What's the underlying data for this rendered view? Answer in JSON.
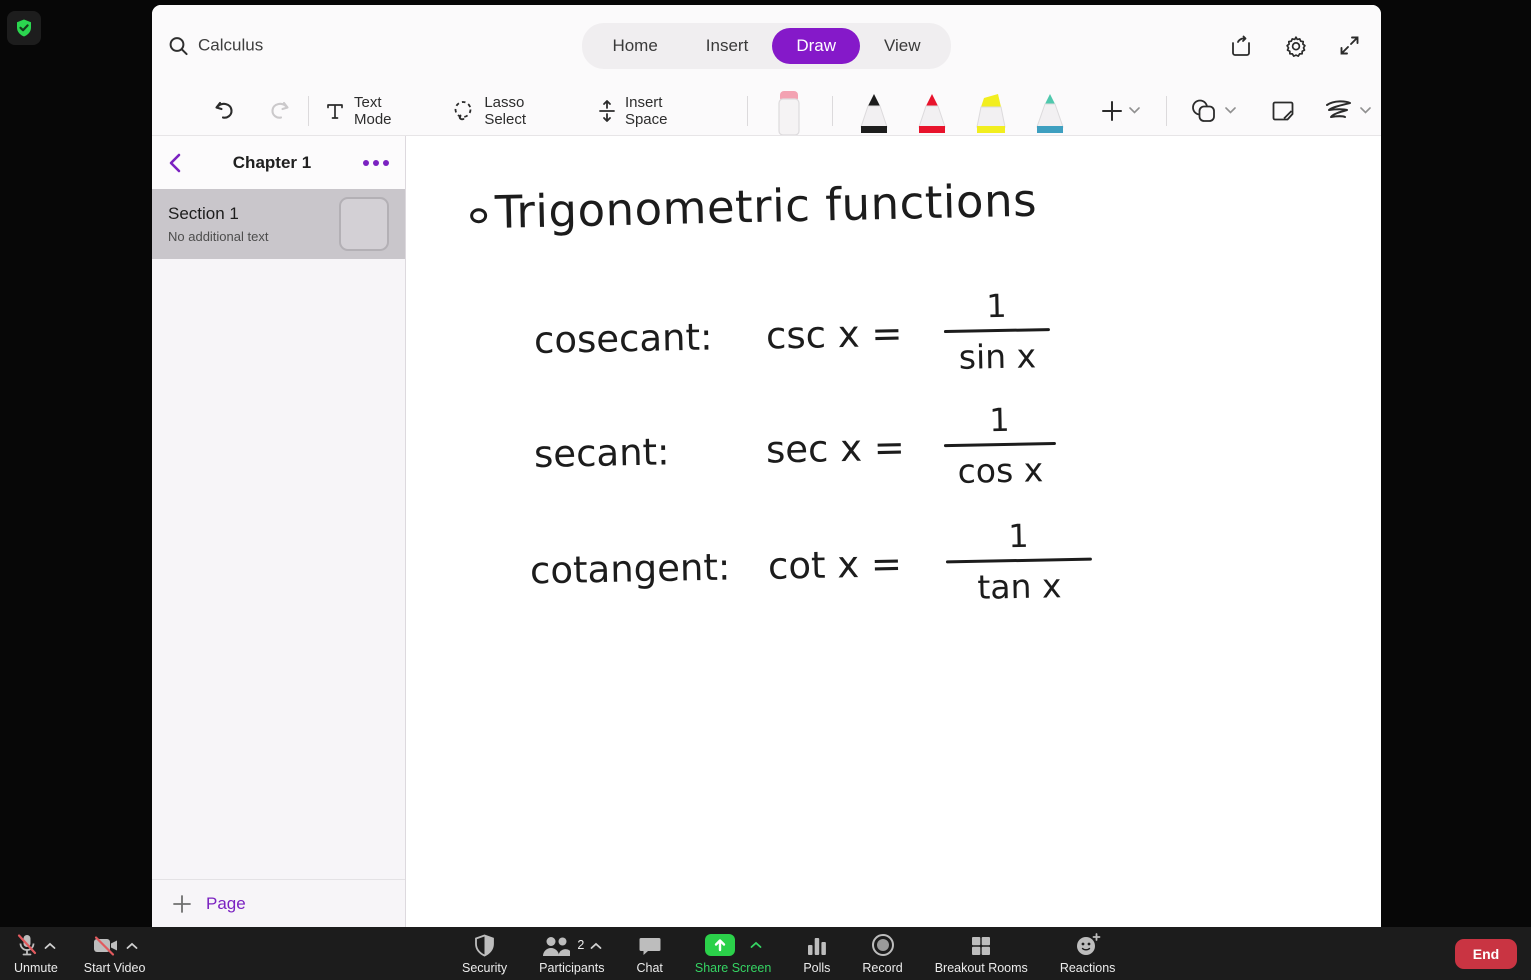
{
  "colors": {
    "accent_purple": "#8519c9",
    "share_green": "#2bd14a",
    "share_green_text": "#35d463",
    "end_red": "#c93442",
    "ink": "#1c1c1c",
    "selected_row_gray": "#c9c6cb"
  },
  "icons": [
    "shield-check-icon",
    "search-icon",
    "share-icon",
    "gear-icon",
    "expand-icon",
    "undo-icon",
    "redo-icon",
    "text-mode-icon",
    "lasso-icon",
    "insert-space-icon",
    "eraser-icon",
    "pen-black-icon",
    "pen-red-icon",
    "highlighter-yellow-icon",
    "pen-teal-icon",
    "plus-icon",
    "chevron-down-icon",
    "shapes-icon",
    "sticky-note-icon",
    "ink-scribble-icon",
    "chevron-left-icon",
    "ellipsis-icon",
    "mic-muted-icon",
    "camera-muted-icon",
    "shield-icon",
    "participants-icon",
    "chat-icon",
    "share-screen-icon",
    "polls-icon",
    "record-icon",
    "breakout-rooms-icon",
    "reactions-icon",
    "chevron-up-icon"
  ],
  "onenote": {
    "search": {
      "value": "Calculus"
    },
    "tabs": [
      {
        "label": "Home",
        "active": false
      },
      {
        "label": "Insert",
        "active": false
      },
      {
        "label": "Draw",
        "active": true
      },
      {
        "label": "View",
        "active": false
      }
    ],
    "ribbon": {
      "text_mode_label": "Text Mode",
      "lasso_label": "Lasso Select",
      "insert_space_label": "Insert Space"
    },
    "sidebar": {
      "title": "Chapter 1",
      "section": {
        "title": "Section 1",
        "subtitle": "No additional text"
      },
      "add_page_label": "Page"
    },
    "canvas": {
      "title": "Trigonometric functions",
      "formulas": [
        {
          "name": "cosecant:",
          "lhs": "csc x =",
          "num": "1",
          "den": "sin x"
        },
        {
          "name": "secant:",
          "lhs": "sec x =",
          "num": "1",
          "den": "cos x"
        },
        {
          "name": "cotangent:",
          "lhs": "cot x =",
          "num": "1",
          "den": "tan x"
        }
      ]
    }
  },
  "zoom_bar": {
    "unmute_label": "Unmute",
    "start_video_label": "Start Video",
    "security_label": "Security",
    "participants_label": "Participants",
    "participants_count": "2",
    "chat_label": "Chat",
    "share_screen_label": "Share Screen",
    "polls_label": "Polls",
    "record_label": "Record",
    "breakout_rooms_label": "Breakout Rooms",
    "reactions_label": "Reactions",
    "end_label": "End"
  }
}
